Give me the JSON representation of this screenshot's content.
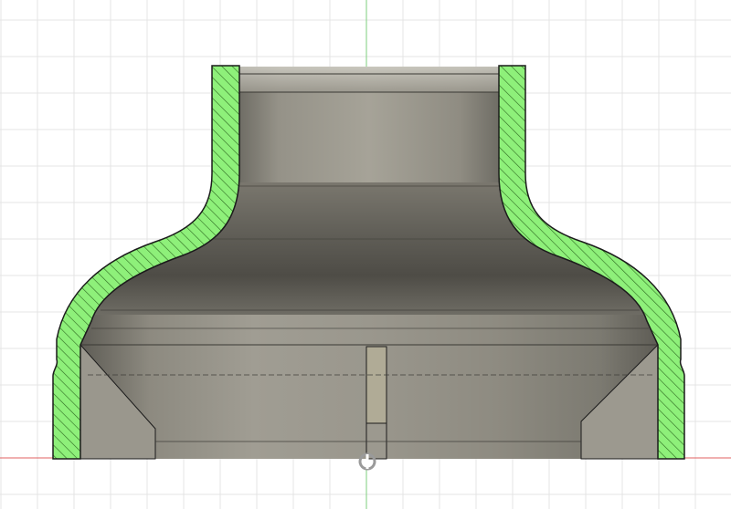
{
  "viewport": {
    "background": "#ffffff",
    "grid_color": "#e4e4e4",
    "axis_vertical_color": "#7ecf7e",
    "axis_horizontal_color": "#e06060"
  },
  "model": {
    "section_fill": "#8ef07a",
    "hatch_color": "#2f6b22",
    "outline_color": "#1b1b1b",
    "body_color": "#8b887e",
    "highlight_color": "#c8c6bd",
    "shadow_color": "#4d4b45"
  },
  "origin_marker": {
    "icon": "origin-pivot-icon",
    "color": "#9a9a9a"
  }
}
